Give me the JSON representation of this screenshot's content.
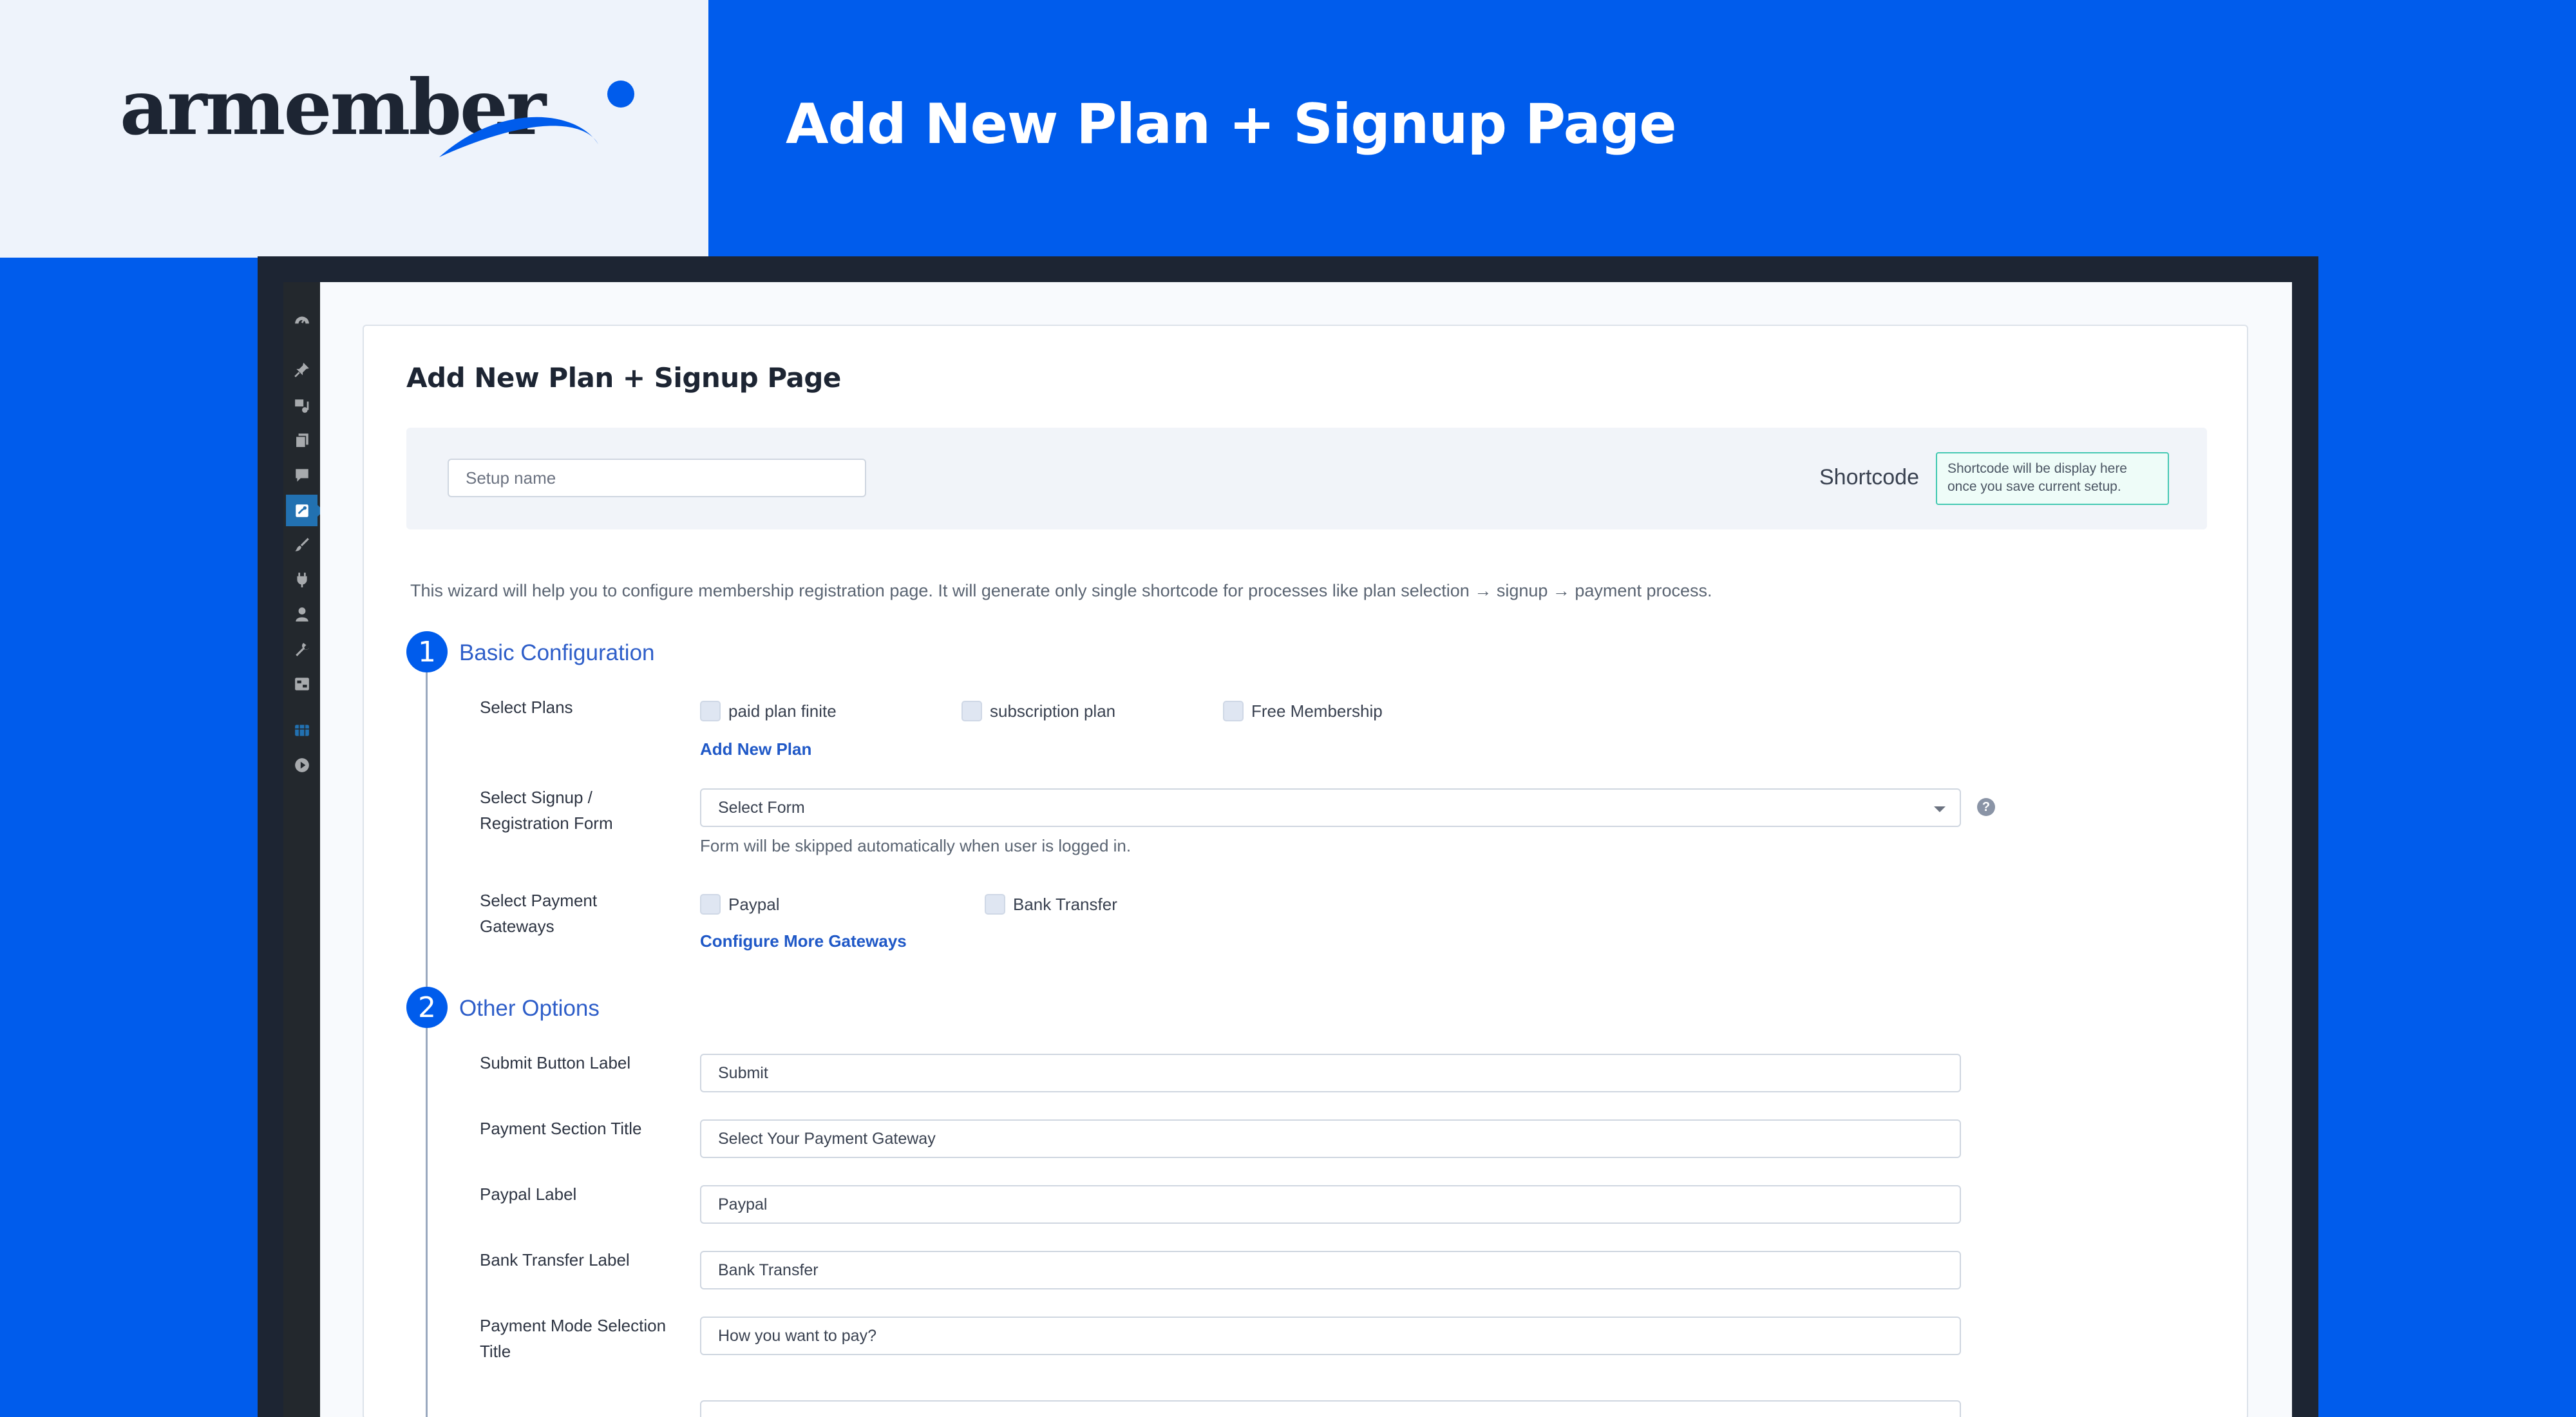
{
  "brand": {
    "logo_text": "armember",
    "banner_title": "Add New Plan + Signup Page",
    "colors": {
      "banner_blue": "#005cec",
      "logo_dark": "#1d2533",
      "brand_panel": "#eef3fb"
    }
  },
  "wp_sidebar": {
    "icons": [
      "dashboard-icon",
      "pin-icon",
      "media-icon",
      "pages-icon",
      "comments-icon",
      "armember-icon",
      "appearance-icon",
      "plugins-icon",
      "users-icon",
      "tools-icon",
      "settings-icon",
      "database-icon",
      "play-icon"
    ],
    "active": "armember-icon"
  },
  "page": {
    "heading": "Add New Plan + Signup Page",
    "setup_name_placeholder": "Setup name",
    "shortcode_label": "Shortcode",
    "shortcode_info": "Shortcode will be display here once you save current setup.",
    "intro": "This wizard will help you to configure membership registration page. It will generate only single shortcode for processes like plan selection → signup → payment process."
  },
  "step1": {
    "number": "1",
    "title": "Basic Configuration",
    "select_plans_label": "Select Plans",
    "plans": [
      "paid plan finite",
      "subscription plan",
      "Free Membership"
    ],
    "add_plan_link": "Add New Plan",
    "signup_form_label": "Select Signup / Registration Form",
    "signup_form_value": "Select Form",
    "signup_form_help": "Form will be skipped automatically when user is logged in.",
    "help_icon": "?",
    "gateways_label": "Select Payment Gateways",
    "gateways": [
      "Paypal",
      "Bank Transfer"
    ],
    "configure_gateways_link": "Configure More Gateways"
  },
  "step2": {
    "number": "2",
    "title": "Other Options",
    "fields": [
      {
        "label": "Submit Button Label",
        "value": "Submit"
      },
      {
        "label": "Payment Section Title",
        "value": "Select Your Payment Gateway"
      },
      {
        "label": "Paypal Label",
        "value": "Paypal"
      },
      {
        "label": "Bank Transfer Label",
        "value": "Bank Transfer"
      },
      {
        "label": "Payment Mode Selection Title",
        "value": "How you want to pay?"
      }
    ]
  }
}
